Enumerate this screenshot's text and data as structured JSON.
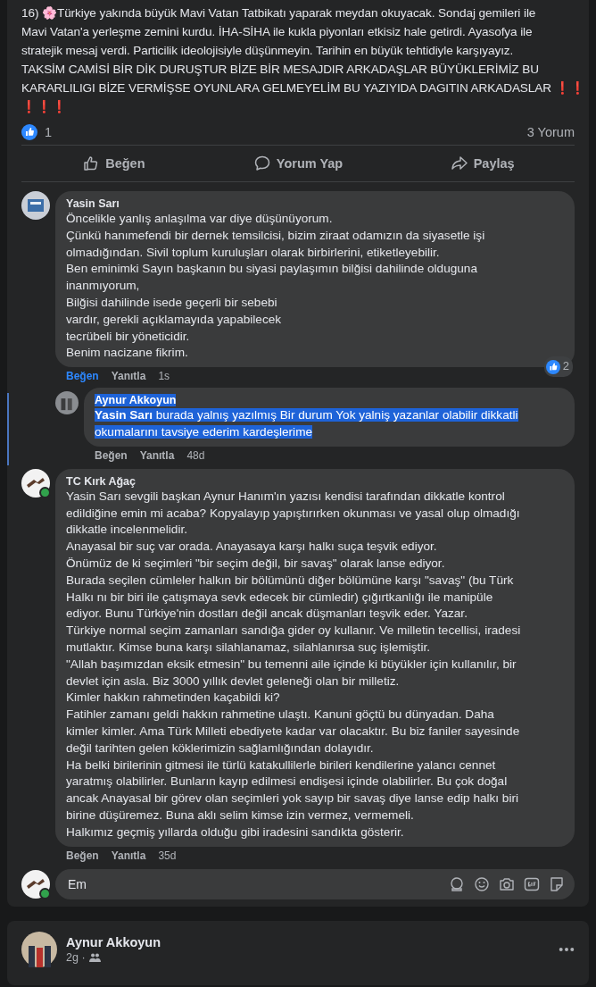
{
  "post": {
    "lines": [
      "16) 🌸Türkiye yakında büyük Mavi Vatan Tatbikatı yaparak meydan okuyacak. Sondaj gemileri ile",
      "Mavi Vatan'a yerleşme zemini kurdu. İHA-SİHA ile kukla piyonları etkisiz hale getirdi. Ayasofya ile",
      "stratejik mesaj verdi. Particilik ideolojisiyle düşünmeyin. Tarihin en büyük tehtidiyle karşıyayız.",
      "TAKSİM CAMİSİ BİR DİK DURUŞTUR  BİZE BİR MESAJDIR ARKADAŞLAR BÜYÜKLERİMİZ BU",
      "KARARLILIGI BİZE VERMİŞSE OYUNLARA GELMEYELİM BU YAZIYIDA DAGITIN ARKADASLAR ❗❗",
      "❗❗❗"
    ],
    "like_count": "1",
    "comment_count": "3 Yorum",
    "actions": [
      {
        "kind": "like",
        "label": "Beğen"
      },
      {
        "kind": "comment",
        "label": "Yorum Yap"
      },
      {
        "kind": "share",
        "label": "Paylaş"
      }
    ]
  },
  "comments": [
    {
      "author": "Yasin Sarı",
      "lines": [
        "Öncelikle yanlış anlaşılma var diye düşünüyorum.",
        "Çünkü hanımefendi bir dernek temsilcisi, bizim ziraat odamızın da siyasetle işi",
        "olmadığından. Sivil toplum kuruluşları olarak birbirlerini, etiketleyebilir.",
        "Ben eminimki Sayın başkanın bu siyasi paylaşımın bilğisi dahilinde olduguna",
        "inanmıyorum,",
        "Bilğisi dahilinde isede geçerli bir sebebi",
        "vardır, gerekli açıklamayıda yapabilecek",
        "tecrübeli bir yöneticidir.",
        "Benim nacizane fikrim."
      ],
      "liked": true,
      "like_label": "Beğen",
      "reply_label": "Yanıtla",
      "time": "1s",
      "reactions": "2",
      "online": false,
      "replies": [
        {
          "author": "Aynur Akkoyun",
          "lines": [
            "**Yasin Sarı** burada yalnış yazılmış Bir durum Yok yalniş yazanlar olabilir dikkatli",
            "okumalarını tavsiye ederim kardeşlerime"
          ],
          "text_selected": true,
          "liked": false,
          "like_label": "Beğen",
          "reply_label": "Yanıtla",
          "time": "48d"
        }
      ]
    },
    {
      "author": "TC Kırk Ağaç",
      "lines": [
        "Yasin Sarı sevgili başkan Aynur Hanım'ın yazısı kendisi tarafından dikkatle kontrol",
        "edildiğine emin mi acaba? Kopyalayıp yapıştırırken okunması ve yasal olup olmadığı",
        "dikkatle incelenmelidir.",
        "Anayasal bir suç var orada. Anayasaya karşı halkı suça teşvik ediyor.",
        "Önümüz de ki seçimleri \"bir seçim değil, bir savaş\" olarak lanse ediyor.",
        "Burada seçilen cümleler halkın bir bölümünü diğer bölümüne karşı \"savaş\" (bu Türk",
        "Halkı nı bir biri ile çatışmaya sevk edecek bir cümledir) çığırtkanlığı ile manipüle",
        "ediyor. Bunu Türkiye'nin dostları değil ancak düşmanları teşvik eder. Yazar.",
        "Türkiye normal seçim zamanları sandığa gider oy kullanır. Ve milletin tecellisi, iradesi",
        "mutlaktır. Kimse buna karşı silahlanamaz, silahlanırsa suç işlemiştir.",
        "\"Allah başımızdan eksik etmesin\" bu temenni aile içinde ki büyükler için kullanılır, bir",
        "devlet için asla. Biz 3000 yıllık devlet geleneği olan bir milletiz.",
        "Kimler hakkın rahmetinden kaçabildi ki?",
        "Fatihler zamanı geldi hakkın rahmetine ulaştı. Kanuni göçtü bu dünyadan. Daha",
        "kimler kimler. Ama Türk Milleti ebediyete kadar var olacaktır. Bu biz faniler sayesinde",
        "değil tarihten gelen köklerimizin sağlamlığından dolayıdır.",
        "Ha belki birilerinin gitmesi ile türlü katakullilerle birileri kendilerine yalancı cennet",
        "yaratmış olabilirler. Bunların kayıp edilmesi endişesi içinde olabilirler. Bu çok doğal",
        "ancak Anayasal bir görev olan seçimleri yok sayıp bir savaş diye lanse edip halkı biri",
        "birine düşüremez. Buna aklı selim kimse izin vermez, vermemeli.",
        "Halkımız geçmiş yıllarda olduğu gibi iradesini sandıkta gösterir."
      ],
      "liked": false,
      "like_label": "Beğen",
      "reply_label": "Yanıtla",
      "time": "35d",
      "online": true
    }
  ],
  "composer": {
    "value": "Em",
    "online": true
  },
  "next_post": {
    "author": "Aynur Akkoyun",
    "time": "2g ·"
  }
}
